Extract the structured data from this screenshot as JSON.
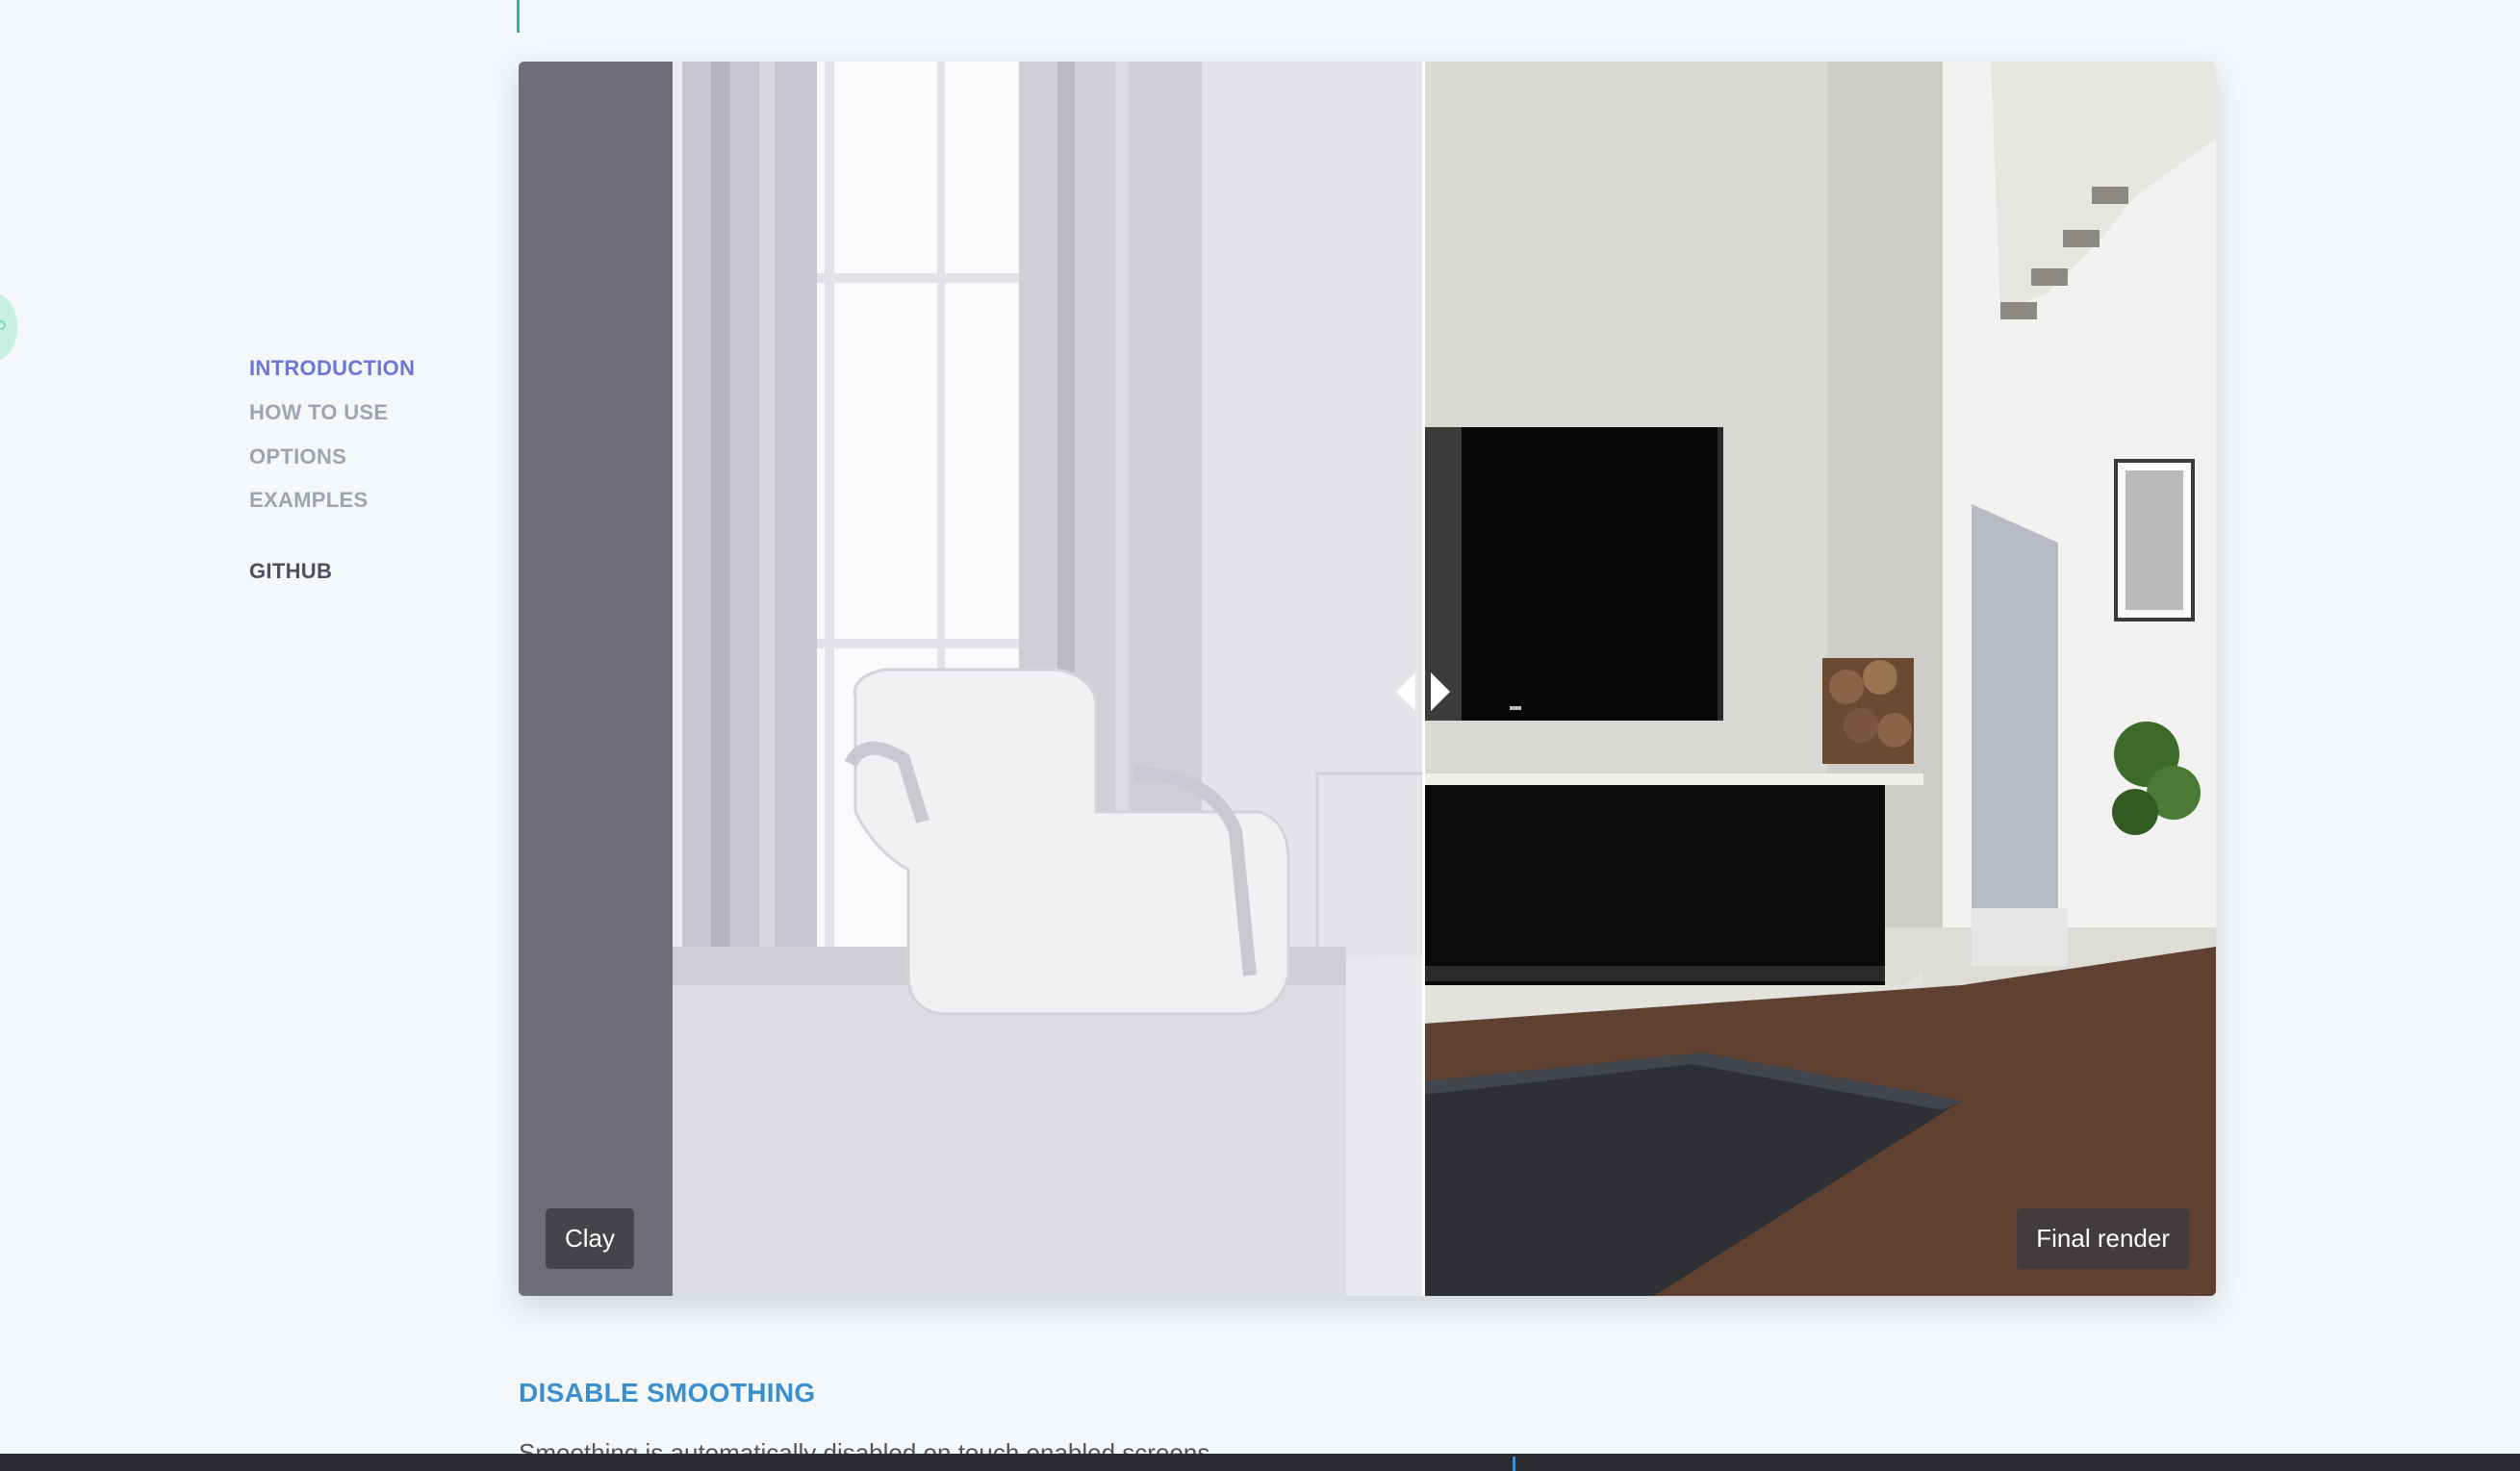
{
  "sidebar": {
    "items": [
      {
        "label": "INTRODUCTION",
        "active": true
      },
      {
        "label": "HOW TO USE",
        "active": false
      },
      {
        "label": "OPTIONS",
        "active": false
      },
      {
        "label": "EXAMPLES",
        "active": false
      }
    ],
    "github_label": "GITHUB"
  },
  "comparison": {
    "before_label": "Clay",
    "after_label": "Final render",
    "handle_icons": [
      "chevron-left-icon",
      "chevron-right-icon"
    ]
  },
  "content": {
    "section_title": "DISABLE SMOOTHING",
    "section_text": "Smoothing is automatically disabled on touch enabled screens."
  },
  "colors": {
    "active_nav": "#6b77d6",
    "nav": "#9ba6b5",
    "section_title": "#3a8fd0",
    "accent_line": "#2fb98f"
  }
}
